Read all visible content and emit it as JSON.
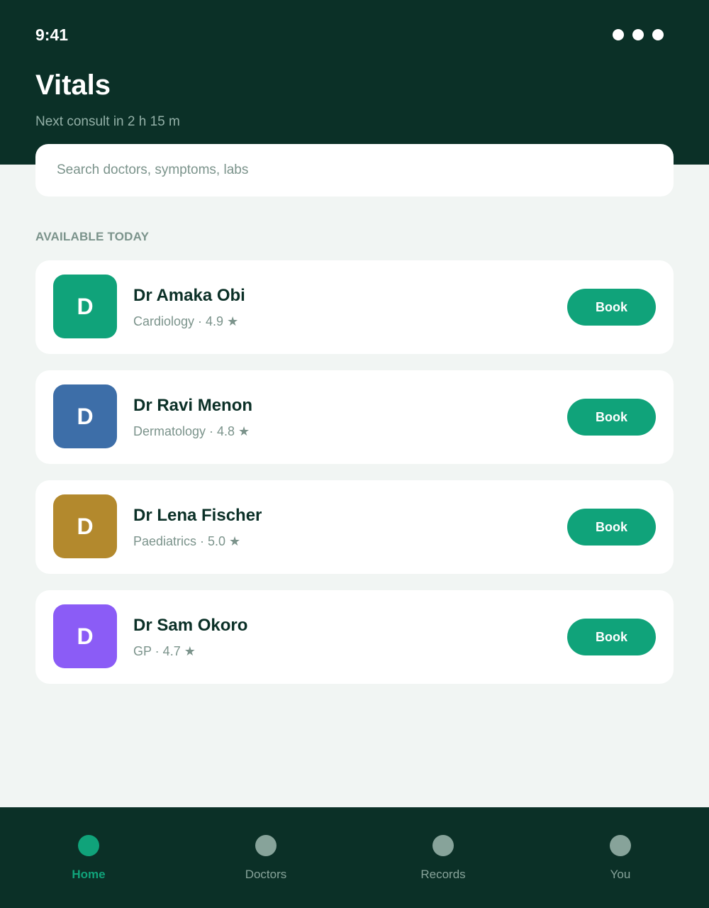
{
  "status_bar": {
    "time": "9:41"
  },
  "header": {
    "title": "Vitals",
    "subtitle": "Next consult in 2 h 15 m"
  },
  "search": {
    "placeholder": "Search doctors, symptoms, labs",
    "value": ""
  },
  "section": {
    "label": "AVAILABLE TODAY"
  },
  "doctors": [
    {
      "initial": "D",
      "name": "Dr Amaka Obi",
      "meta": "Cardiology · 4.9 ★",
      "book_label": "Book",
      "color": "#10a37a"
    },
    {
      "initial": "D",
      "name": "Dr Ravi Menon",
      "meta": "Dermatology · 4.8 ★",
      "book_label": "Book",
      "color": "#3d6ea8"
    },
    {
      "initial": "D",
      "name": "Dr Lena Fischer",
      "meta": "Paediatrics · 5.0 ★",
      "book_label": "Book",
      "color": "#b3892d"
    },
    {
      "initial": "D",
      "name": "Dr Sam Okoro",
      "meta": "GP · 4.7 ★",
      "book_label": "Book",
      "color": "#8b5cf6"
    }
  ],
  "tabs": [
    {
      "label": "Home",
      "icon": "home-icon",
      "active": true
    },
    {
      "label": "Doctors",
      "icon": "doctors-icon",
      "active": false
    },
    {
      "label": "Records",
      "icon": "records-icon",
      "active": false
    },
    {
      "label": "You",
      "icon": "profile-icon",
      "active": false
    }
  ],
  "colors": {
    "header_bg": "#0b3027",
    "accent": "#10a37a",
    "muted": "#7b938b",
    "page_bg": "#f1f5f3"
  }
}
